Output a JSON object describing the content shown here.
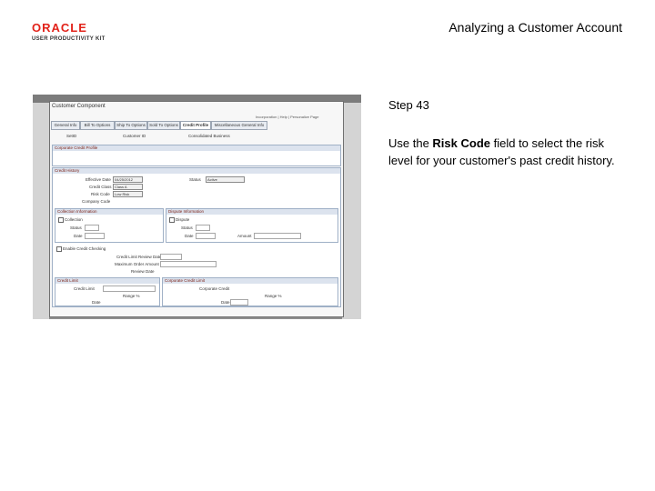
{
  "header": {
    "logo_brand": "ORACLE",
    "logo_sub": "USER PRODUCTIVITY KIT",
    "doc_title": "Analyzing a Customer Account"
  },
  "panel": {
    "step": "Step 43",
    "instruction_pre": "Use the ",
    "instruction_bold": "Risk Code",
    "instruction_post": " field to select the risk level for your customer's past credit history."
  },
  "screenshot": {
    "window_title": "Customer Component",
    "nav_links": "Incorporation | Help | Personalize Page",
    "tabs": [
      "General Info",
      "Bill To Options",
      "Ship To Options",
      "Sold To Options",
      "Credit Profile",
      "Miscellaneous General Info"
    ],
    "active_tab": "Credit Profile",
    "summary": {
      "setid_label": "SetID",
      "customer_id_label": "Customer ID",
      "business_label": "Consolidated Business"
    },
    "groups": {
      "corporate": "Corporate Credit Profile",
      "credit_history": "Credit History",
      "collection": "Collection Information",
      "dispute": "Dispute Information",
      "credit": "Credit Limit",
      "corporate_limit": "Corporate Credit Limit"
    },
    "fields": {
      "effective_date_label": "Effective Date",
      "effective_date_value": "04/25/2012",
      "status_label": "Status",
      "status_value": "Active",
      "credit_class_label": "Credit Class",
      "credit_class_value": "Class A",
      "risk_code_label": "Risk Code",
      "risk_code_value": "Low Risk",
      "company_code_label": "Company Code",
      "collection_label": "Collection",
      "dispute_label": "Dispute",
      "status_short": "Status",
      "date_label": "Date",
      "amount_label": "Amount",
      "enable_credit_label": "Enable Credit Checking",
      "credit_limit_label": "Credit Limit Review Date",
      "max_order_label": "Maximum Order Amount",
      "review_date_label": "Review Date",
      "credit_limit_field": "Credit Limit",
      "range_label": "Range %",
      "corporate_credit_label": "Corporate Credit",
      "date2_label": "Date"
    }
  }
}
